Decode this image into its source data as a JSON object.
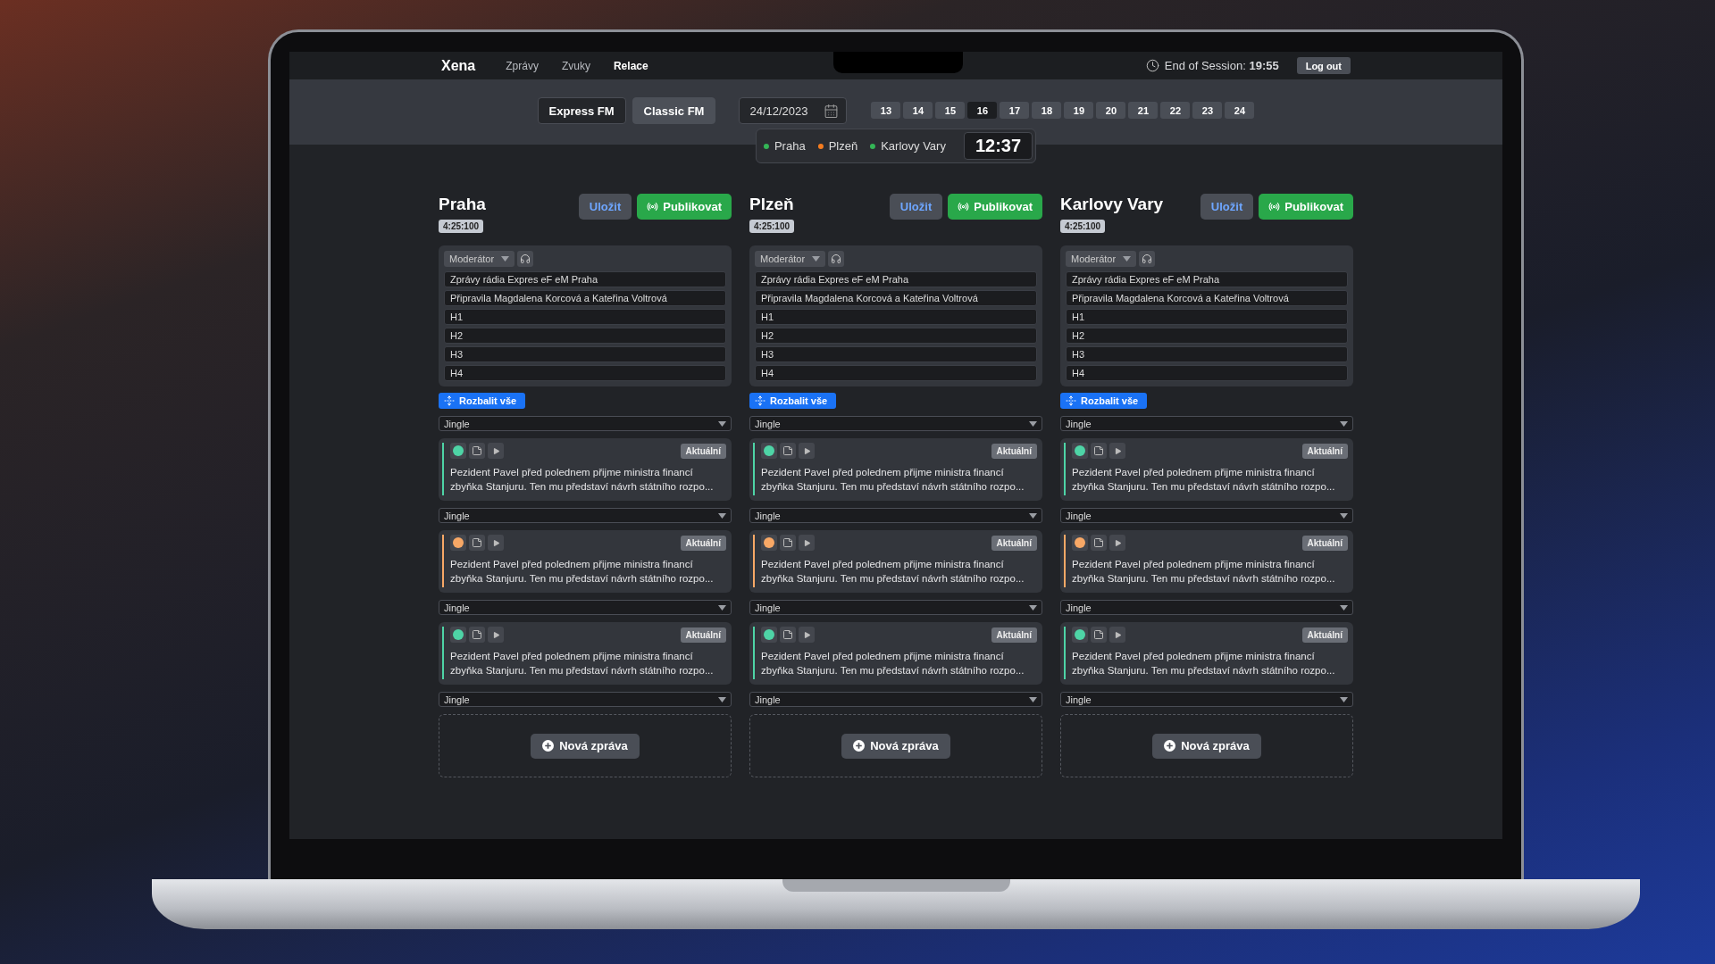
{
  "nav": {
    "brand": "Xena",
    "items": [
      {
        "label": "Zprávy",
        "selected": false
      },
      {
        "label": "Zvuky",
        "selected": false
      },
      {
        "label": "Relace",
        "selected": true
      }
    ],
    "session_label": "End of Session:",
    "session_time": "19:55",
    "logout": "Log out"
  },
  "toolbar": {
    "stations": [
      {
        "label": "Express FM",
        "selected": true
      },
      {
        "label": "Classic FM",
        "selected": false
      }
    ],
    "date": "24/12/2023",
    "days": [
      {
        "label": "13",
        "selected": false
      },
      {
        "label": "14",
        "selected": false
      },
      {
        "label": "15",
        "selected": false
      },
      {
        "label": "16",
        "selected": true
      },
      {
        "label": "17",
        "selected": false
      },
      {
        "label": "18",
        "selected": false
      },
      {
        "label": "19",
        "selected": false
      },
      {
        "label": "20",
        "selected": false
      },
      {
        "label": "21",
        "selected": false
      },
      {
        "label": "22",
        "selected": false
      },
      {
        "label": "23",
        "selected": false
      },
      {
        "label": "24",
        "selected": false
      }
    ]
  },
  "status": {
    "regions": [
      {
        "label": "Praha",
        "color": "#34b556"
      },
      {
        "label": "Plzeň",
        "color": "#f57c1f"
      },
      {
        "label": "Karlovy Vary",
        "color": "#34b556"
      }
    ],
    "clock": "12:37"
  },
  "columns": [
    {
      "title": "Praha",
      "duration": "4:25:100",
      "save": "Uložit",
      "publish": "Publikovat",
      "moderator": "Moderátor",
      "fields": [
        "Zprávy rádia Expres eF eM Praha",
        "Připravila Magdalena Korcová a Kateřina Voltrová",
        "H1",
        "H2",
        "H3",
        "H4"
      ],
      "expand": "Rozbalit vše",
      "items": [
        {
          "jingle": "Jingle",
          "color": "#4ed4a6",
          "badge": "Aktuální",
          "text": "Pezident Pavel před polednem přijme ministra financí zbyňka Stanjuru. Ten mu představí návrh státního rozpo..."
        },
        {
          "jingle": "Jingle",
          "color": "#f8a866",
          "badge": "Aktuální",
          "text": "Pezident Pavel před polednem přijme ministra financí zbyňka Stanjuru. Ten mu představí návrh státního rozpo..."
        },
        {
          "jingle": "Jingle",
          "color": "#4ed4a6",
          "badge": "Aktuální",
          "text": "Pezident Pavel před polednem přijme ministra financí zbyňka Stanjuru. Ten mu představí návrh státního rozpo..."
        }
      ],
      "last_jingle": "Jingle",
      "new_message": "Nová zpráva"
    },
    {
      "title": "Plzeň",
      "duration": "4:25:100",
      "save": "Uložit",
      "publish": "Publikovat",
      "moderator": "Moderátor",
      "fields": [
        "Zprávy rádia Expres eF eM Praha",
        "Připravila Magdalena Korcová a Kateřina Voltrová",
        "H1",
        "H2",
        "H3",
        "H4"
      ],
      "expand": "Rozbalit vše",
      "items": [
        {
          "jingle": "Jingle",
          "color": "#4ed4a6",
          "badge": "Aktuální",
          "text": "Pezident Pavel před polednem přijme ministra financí zbyňka Stanjuru. Ten mu představí návrh státního rozpo..."
        },
        {
          "jingle": "Jingle",
          "color": "#f8a866",
          "badge": "Aktuální",
          "text": "Pezident Pavel před polednem přijme ministra financí zbyňka Stanjuru. Ten mu představí návrh státního rozpo..."
        },
        {
          "jingle": "Jingle",
          "color": "#4ed4a6",
          "badge": "Aktuální",
          "text": "Pezident Pavel před polednem přijme ministra financí zbyňka Stanjuru. Ten mu představí návrh státního rozpo..."
        }
      ],
      "last_jingle": "Jingle",
      "new_message": "Nová zpráva"
    },
    {
      "title": "Karlovy Vary",
      "duration": "4:25:100",
      "save": "Uložit",
      "publish": "Publikovat",
      "moderator": "Moderátor",
      "fields": [
        "Zprávy rádia Expres eF eM Praha",
        "Připravila Magdalena Korcová a Kateřina Voltrová",
        "H1",
        "H2",
        "H3",
        "H4"
      ],
      "expand": "Rozbalit vše",
      "items": [
        {
          "jingle": "Jingle",
          "color": "#4ed4a6",
          "badge": "Aktuální",
          "text": "Pezident Pavel před polednem přijme ministra financí zbyňka Stanjuru. Ten mu představí návrh státního rozpo..."
        },
        {
          "jingle": "Jingle",
          "color": "#f8a866",
          "badge": "Aktuální",
          "text": "Pezident Pavel před polednem přijme ministra financí zbyňka Stanjuru. Ten mu představí návrh státního rozpo..."
        },
        {
          "jingle": "Jingle",
          "color": "#4ed4a6",
          "badge": "Aktuální",
          "text": "Pezident Pavel před polednem přijme ministra financí zbyňka Stanjuru. Ten mu představí návrh státního rozpo..."
        }
      ],
      "last_jingle": "Jingle",
      "new_message": "Nová zpráva"
    }
  ]
}
